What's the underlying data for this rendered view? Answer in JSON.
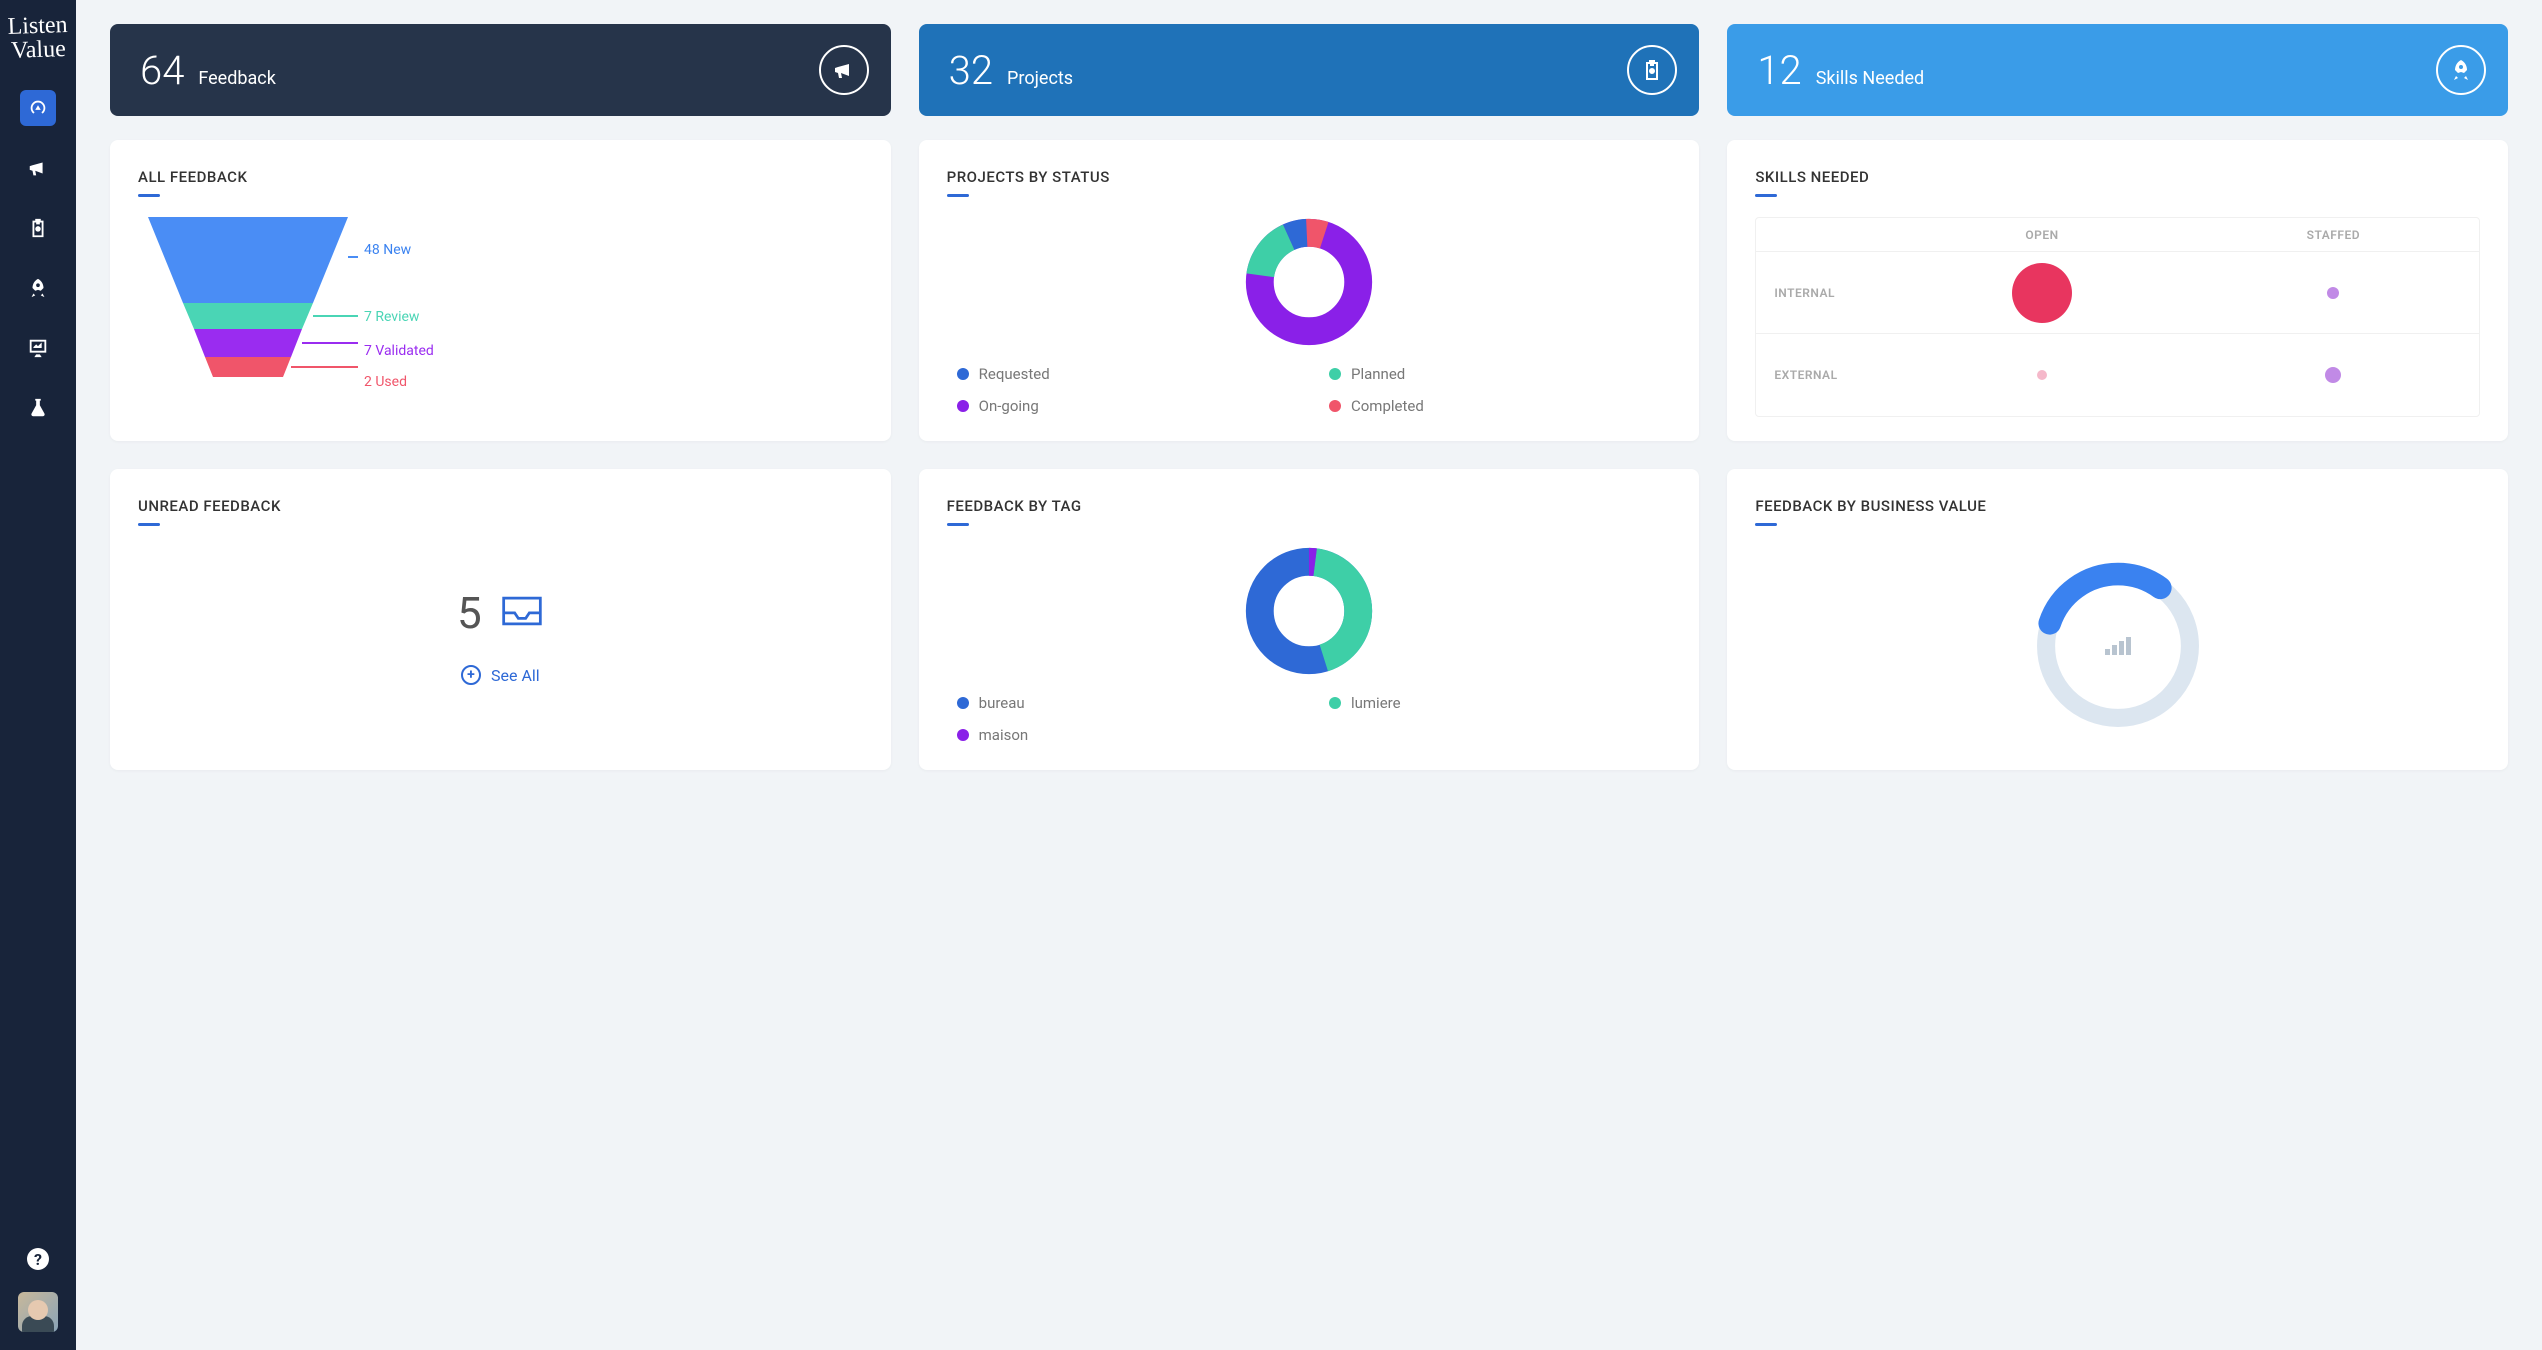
{
  "brand": {
    "line1": "Listen",
    "line2": "Value"
  },
  "sidebar": {
    "items": [
      {
        "name": "dashboard",
        "active": true
      },
      {
        "name": "feedback",
        "active": false
      },
      {
        "name": "projects",
        "active": false
      },
      {
        "name": "skills",
        "active": false
      },
      {
        "name": "analytics",
        "active": false
      },
      {
        "name": "lab",
        "active": false
      }
    ]
  },
  "stats": {
    "feedback": {
      "value": "64",
      "label": "Feedback"
    },
    "projects": {
      "value": "32",
      "label": "Projects"
    },
    "skills": {
      "value": "12",
      "label": "Skills Needed"
    }
  },
  "cards": {
    "all_feedback": {
      "title": "ALL FEEDBACK",
      "stages": [
        {
          "label": "48 New",
          "color": "#3a82f0"
        },
        {
          "label": "7 Review",
          "color": "#4ad5b5"
        },
        {
          "label": "7 Validated",
          "color": "#9a2cf0"
        },
        {
          "label": "2 Used",
          "color": "#f0556a"
        }
      ]
    },
    "projects_by_status": {
      "title": "PROJECTS BY STATUS",
      "legend": [
        {
          "label": "Requested",
          "color": "#2e69d6"
        },
        {
          "label": "Planned",
          "color": "#3ecfa7"
        },
        {
          "label": "On-going",
          "color": "#8a20e8"
        },
        {
          "label": "Completed",
          "color": "#f0556a"
        }
      ]
    },
    "skills_needed": {
      "title": "SKILLS NEEDED",
      "cols": [
        "OPEN",
        "STAFFED"
      ],
      "rows": [
        "INTERNAL",
        "EXTERNAL"
      ]
    },
    "unread_feedback": {
      "title": "UNREAD FEEDBACK",
      "count": "5",
      "see_all": "See All"
    },
    "feedback_by_tag": {
      "title": "FEEDBACK BY TAG",
      "legend": [
        {
          "label": "bureau",
          "color": "#2e69d6"
        },
        {
          "label": "lumiere",
          "color": "#3ecfa7"
        },
        {
          "label": "maison",
          "color": "#8a20e8"
        }
      ]
    },
    "feedback_by_value": {
      "title": "FEEDBACK BY BUSINESS VALUE"
    }
  },
  "chart_data": [
    {
      "type": "bar",
      "name": "all_feedback_funnel",
      "categories": [
        "New",
        "Review",
        "Validated",
        "Used"
      ],
      "values": [
        48,
        7,
        7,
        2
      ],
      "title": "ALL FEEDBACK"
    },
    {
      "type": "pie",
      "name": "projects_by_status_donut",
      "categories": [
        "Requested",
        "Planned",
        "On-going",
        "Completed"
      ],
      "values": [
        2,
        5,
        23,
        2
      ],
      "title": "PROJECTS BY STATUS"
    },
    {
      "type": "table",
      "name": "skills_needed_matrix",
      "cols": [
        "OPEN",
        "STAFFED"
      ],
      "rows": [
        "INTERNAL",
        "EXTERNAL"
      ],
      "values": [
        [
          9,
          1
        ],
        [
          1,
          2
        ]
      ],
      "title": "SKILLS NEEDED"
    },
    {
      "type": "pie",
      "name": "feedback_by_tag_donut",
      "categories": [
        "bureau",
        "lumiere",
        "maison"
      ],
      "values": [
        55,
        43,
        2
      ],
      "title": "FEEDBACK BY TAG"
    },
    {
      "type": "pie",
      "name": "feedback_by_business_value_gauge",
      "categories": [
        "filled",
        "remaining"
      ],
      "values": [
        30,
        70
      ],
      "title": "FEEDBACK BY BUSINESS VALUE"
    }
  ]
}
